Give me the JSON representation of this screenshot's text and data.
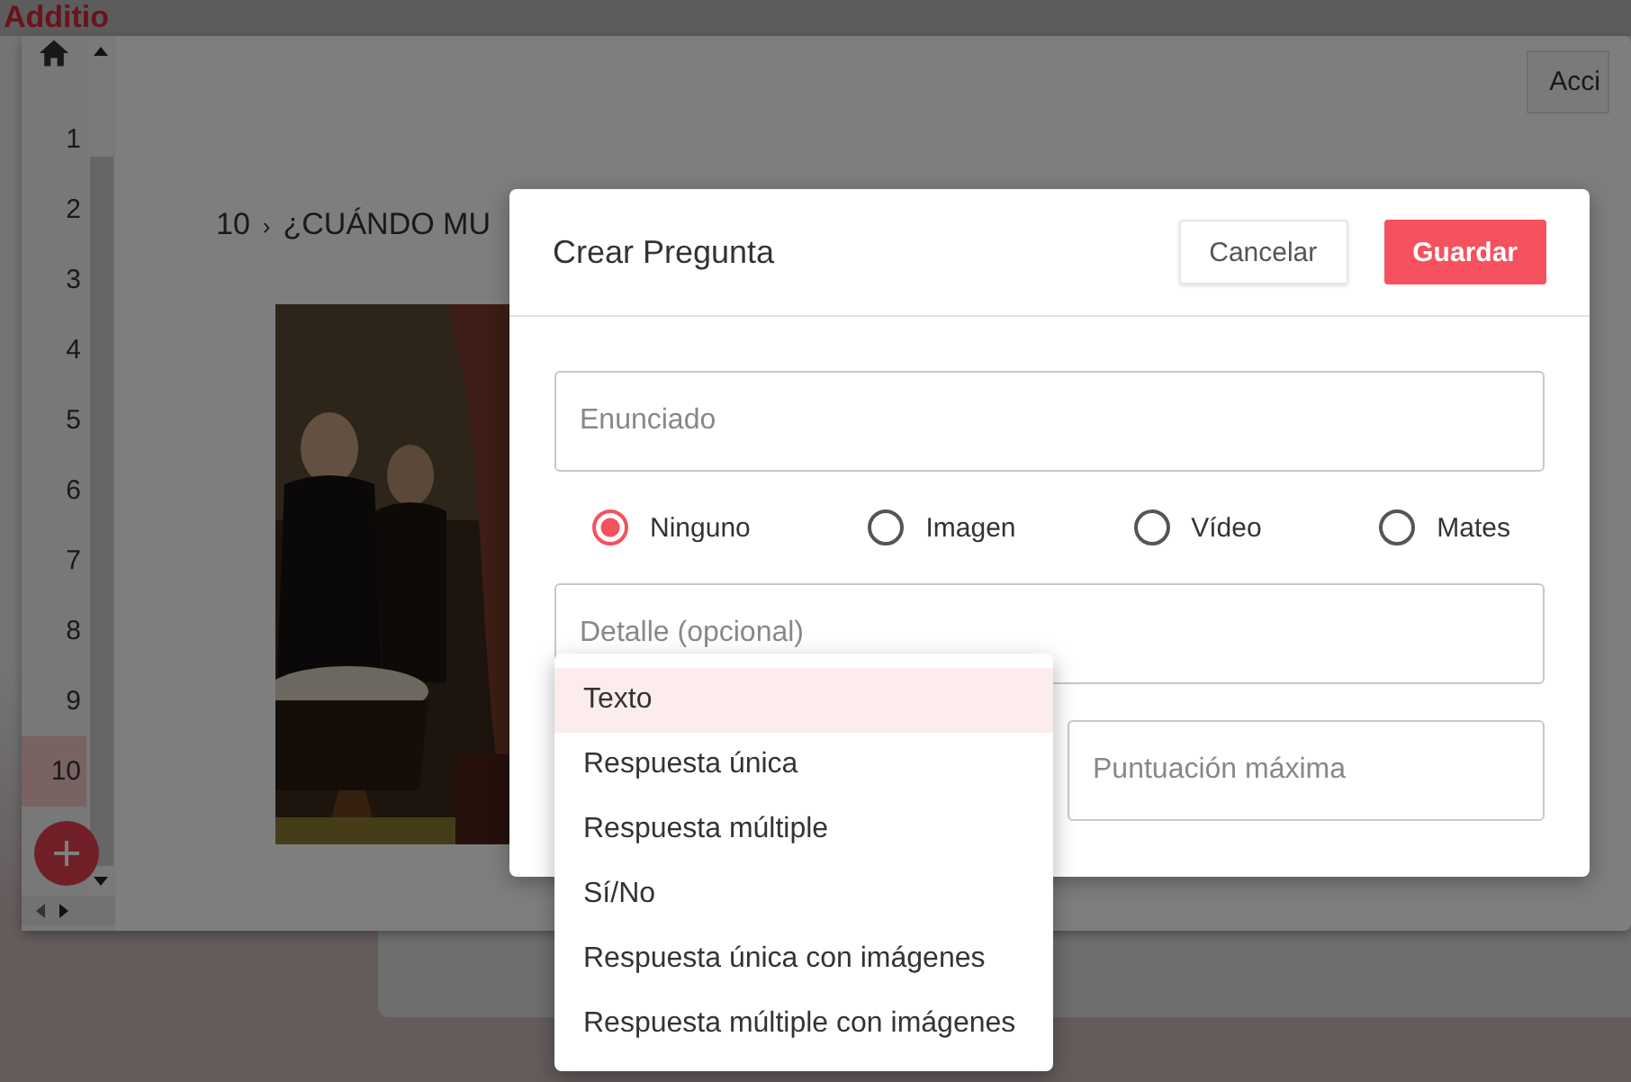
{
  "app": {
    "logo": "Additio"
  },
  "sidebar": {
    "items": [
      {
        "label": "1",
        "selected": false
      },
      {
        "label": "2",
        "selected": false
      },
      {
        "label": "3",
        "selected": false
      },
      {
        "label": "4",
        "selected": false
      },
      {
        "label": "5",
        "selected": false
      },
      {
        "label": "6",
        "selected": false
      },
      {
        "label": "7",
        "selected": false
      },
      {
        "label": "8",
        "selected": false
      },
      {
        "label": "9",
        "selected": false
      },
      {
        "label": "10",
        "selected": true
      }
    ]
  },
  "toolbar": {
    "button": "Acci"
  },
  "question": {
    "number": "10",
    "separator": "›",
    "title": "¿CUÁNDO MU"
  },
  "dialog": {
    "title": "Crear Pregunta",
    "buttons": [
      {
        "label": "Cancelar",
        "kind": "secondary"
      },
      {
        "label": "Guardar",
        "kind": "primary"
      }
    ],
    "statement": {
      "placeholder": "Enunciado"
    },
    "media_options": [
      {
        "label": "Ninguno",
        "selected": true
      },
      {
        "label": "Imagen",
        "selected": false
      },
      {
        "label": "Vídeo",
        "selected": false
      },
      {
        "label": "Mates",
        "selected": false
      }
    ],
    "detail": {
      "placeholder": "Detalle (opcional)"
    },
    "max_score": {
      "placeholder": "Puntuación máxima"
    },
    "type_menu": {
      "options": [
        {
          "label": "Texto",
          "selected": true
        },
        {
          "label": "Respuesta única",
          "selected": false
        },
        {
          "label": "Respuesta múltiple",
          "selected": false
        },
        {
          "label": "Sí/No",
          "selected": false
        },
        {
          "label": "Respuesta única con imágenes",
          "selected": false
        },
        {
          "label": "Respuesta múltiple con imágenes",
          "selected": false
        }
      ]
    }
  }
}
